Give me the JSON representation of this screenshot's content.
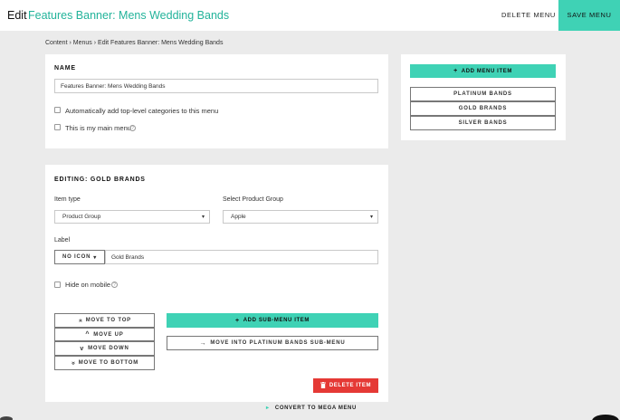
{
  "header": {
    "edit_word": "Edit",
    "menu_name": "Features Banner: Mens Wedding Bands",
    "delete_menu": "DELETE MENU",
    "save_menu": "SAVE MENU"
  },
  "breadcrumb": {
    "content": "Content",
    "menus": "Menus",
    "current": "Edit Features Banner: Mens Wedding Bands",
    "separator": "›"
  },
  "name_panel": {
    "heading": "NAME",
    "name_value": "Features Banner: Mens Wedding Bands",
    "auto_add_label": "Automatically add top-level categories to this menu",
    "main_menu_label": "This is my main menu",
    "help_glyph": "?"
  },
  "items_panel": {
    "add_menu_item": "ADD MENU ITEM",
    "items": [
      "PLATINUM BANDS",
      "GOLD BRANDS",
      "SILVER BANDS"
    ]
  },
  "editing_panel": {
    "heading": "EDITING: GOLD BRANDS",
    "item_type_label": "Item type",
    "item_type_value": "Product Group",
    "product_group_label": "Select Product Group",
    "product_group_value": "Apple",
    "label_label": "Label",
    "icon_button": "NO ICON",
    "label_value": "Gold Brands",
    "hide_mobile_label": "Hide on mobile",
    "move_to_top": "MOVE TO TOP",
    "move_up": "MOVE UP",
    "move_down": "MOVE DOWN",
    "move_to_bottom": "MOVE TO BOTTOM",
    "add_sub_menu_item": "ADD SUB-MENU ITEM",
    "move_into_sub_menu": "MOVE INTO PLATINUM BANDS SUB-MENU",
    "delete_item": "DELETE ITEM"
  },
  "footer": {
    "convert_mega_menu": "CONVERT TO MEGA MENU"
  },
  "colors": {
    "accent": "#3fd2b5",
    "title_accent": "#22b39a",
    "danger": "#e53935",
    "background": "#ebebeb"
  },
  "icons": {
    "plus": "+",
    "chevron_down": "▾",
    "double_up": "«",
    "up": "^",
    "down": "v",
    "double_down": "»",
    "arrow_right": "→",
    "trash": "🗑",
    "triangle_right": "▸"
  }
}
